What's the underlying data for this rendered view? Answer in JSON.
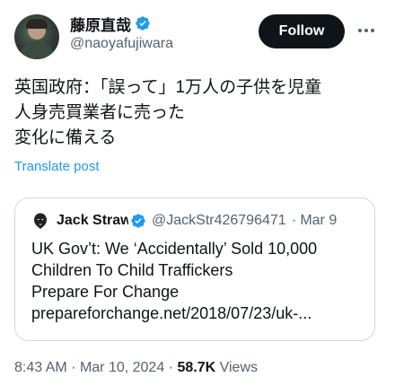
{
  "author": {
    "display_name": "藤原直哉",
    "handle": "@naoyafujiwara",
    "avatar_icon": "profile-photo",
    "verified_icon": "verified-badge-icon"
  },
  "actions": {
    "follow_label": "Follow",
    "more_icon": "more-options-icon"
  },
  "tweet": {
    "lines": [
      "英国政府：「誤って」1万人の子供を児童",
      "人身売買業者に売った",
      "変化に備える"
    ],
    "translate_label": "Translate post"
  },
  "quote": {
    "display_name": "Jack Straw",
    "handle": "@JackStr426796471",
    "separator": "·",
    "date": "Mar 9",
    "avatar_icon": "hooded-avatar-icon",
    "lines": [
      "UK Gov’t: We ‘Accidentally’ Sold 10,000",
      "Children To Child Traffickers",
      "Prepare For Change",
      "prepareforchange.net/2018/07/23/uk-..."
    ]
  },
  "meta": {
    "time": "8:43 AM",
    "date": "Mar 10, 2024",
    "separator": "·",
    "views_count": "58.7K",
    "views_label": "Views"
  },
  "colors": {
    "text": "#0f1419",
    "secondary": "#536471",
    "link": "#1d9bf0",
    "verified": "#1d9bf0",
    "border": "#cfd9de"
  }
}
